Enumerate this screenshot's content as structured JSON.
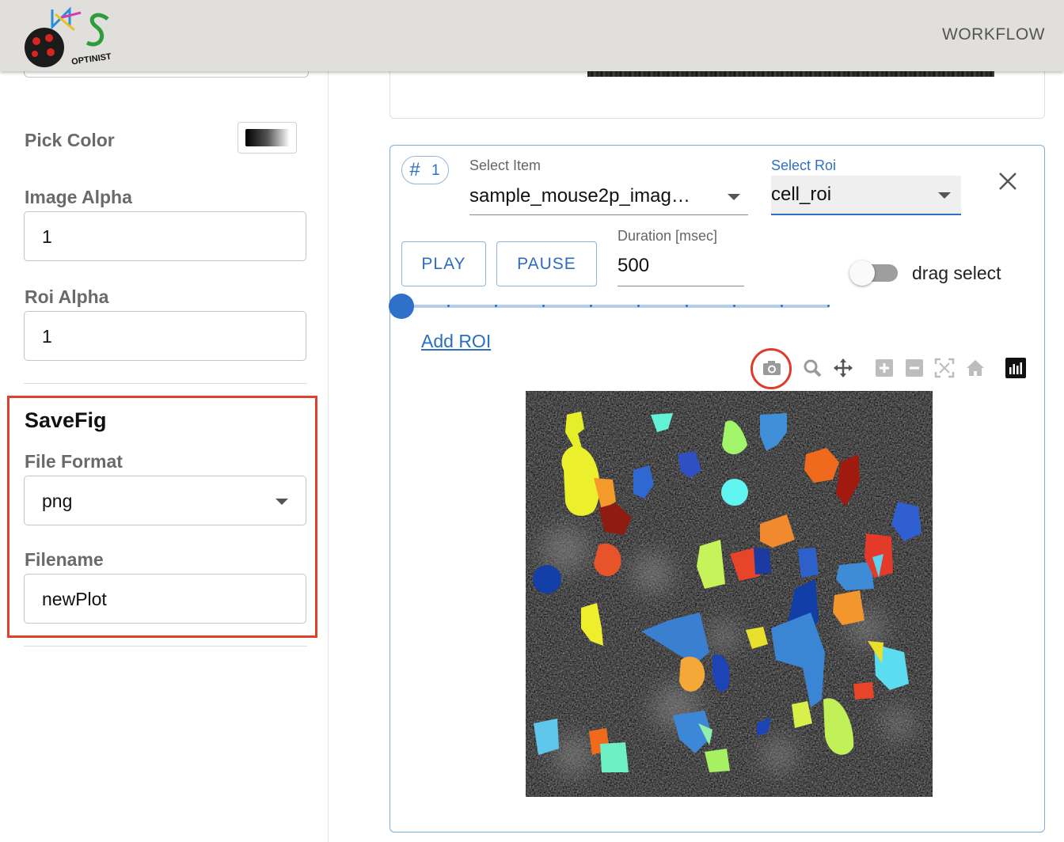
{
  "appbar": {
    "logo_text": "OPTINIST",
    "workflow_label": "WORKFLOW"
  },
  "sidebar": {
    "pick_color_label": "Pick Color",
    "image_alpha_label": "Image Alpha",
    "image_alpha_value": "1",
    "roi_alpha_label": "Roi Alpha",
    "roi_alpha_value": "1",
    "savefig": {
      "title": "SaveFig",
      "file_format_label": "File Format",
      "file_format_value": "png",
      "filename_label": "Filename",
      "filename_value": "newPlot"
    }
  },
  "card": {
    "chip_hash": "#",
    "chip_number": "1",
    "select_item_label": "Select Item",
    "select_item_value": "sample_mouse2p_imag…",
    "select_roi_label": "Select Roi",
    "select_roi_value": "cell_roi",
    "play_label": "PLAY",
    "pause_label": "PAUSE",
    "duration_label": "Duration [msec]",
    "duration_value": "500",
    "drag_select_label": "drag select",
    "drag_select_on": false,
    "slider_position": 0,
    "add_roi_label": "Add ROI",
    "modebar_icons": [
      "camera-icon",
      "zoom-icon",
      "pan-icon",
      "zoom-in-icon",
      "zoom-out-icon",
      "autoscale-icon",
      "home-icon",
      "plotly-logo-icon"
    ]
  },
  "colors": {
    "accent": "#2f6fc5",
    "highlight": "#e0412c",
    "appbar": "#e0dfdc"
  }
}
